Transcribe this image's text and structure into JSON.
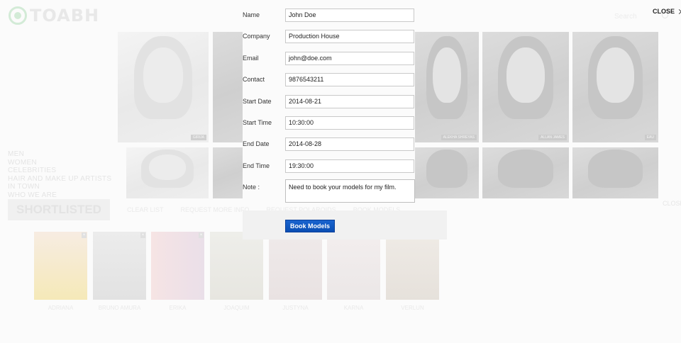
{
  "logo": {
    "text": "TOABH"
  },
  "header": {
    "close_label": "CLOSE",
    "search_placeholder": "Search"
  },
  "side_nav": [
    "MEN",
    "WOMEN",
    "CELEBRITIES",
    "HAIR AND MAKE UP ARTISTS",
    "IN TOWN",
    "WHO WE ARE"
  ],
  "gallery_captions": [
    "GIRIJA",
    "ALEKHA SHREYAS",
    "ALLAN JAMES",
    "EAU"
  ],
  "shortlist": {
    "title": "SHORTLISTED",
    "links": [
      "CLEAR LIST",
      "REQUEST MORE INFO",
      "REQUEST POLAROIDS",
      "BOOK MODELS"
    ],
    "close_label": "CLOSE",
    "models": [
      "ADRIANA",
      "BRUNO AMURA",
      "ERIKA",
      "JOAQUIM",
      "JUSTYNA",
      "KARNA",
      "VERLUN"
    ]
  },
  "form": {
    "fields": [
      {
        "label": "Name",
        "value": "John Doe"
      },
      {
        "label": "Company",
        "value": "Production House"
      },
      {
        "label": "Email",
        "value": "john@doe.com"
      },
      {
        "label": "Contact",
        "value": "9876543211"
      },
      {
        "label": "Start Date",
        "value": "2014-08-21"
      },
      {
        "label": "Start Time",
        "value": "10:30:00"
      },
      {
        "label": "End Date",
        "value": "2014-08-28"
      },
      {
        "label": "End Time",
        "value": "19:30:00"
      }
    ],
    "note_label": "Note :",
    "note_value": "Need to book your models for my film.",
    "submit_label": "Book Models"
  },
  "colors": {
    "accent": "#0b52ba",
    "text": "#333333",
    "faded": "#e6e6e6"
  }
}
